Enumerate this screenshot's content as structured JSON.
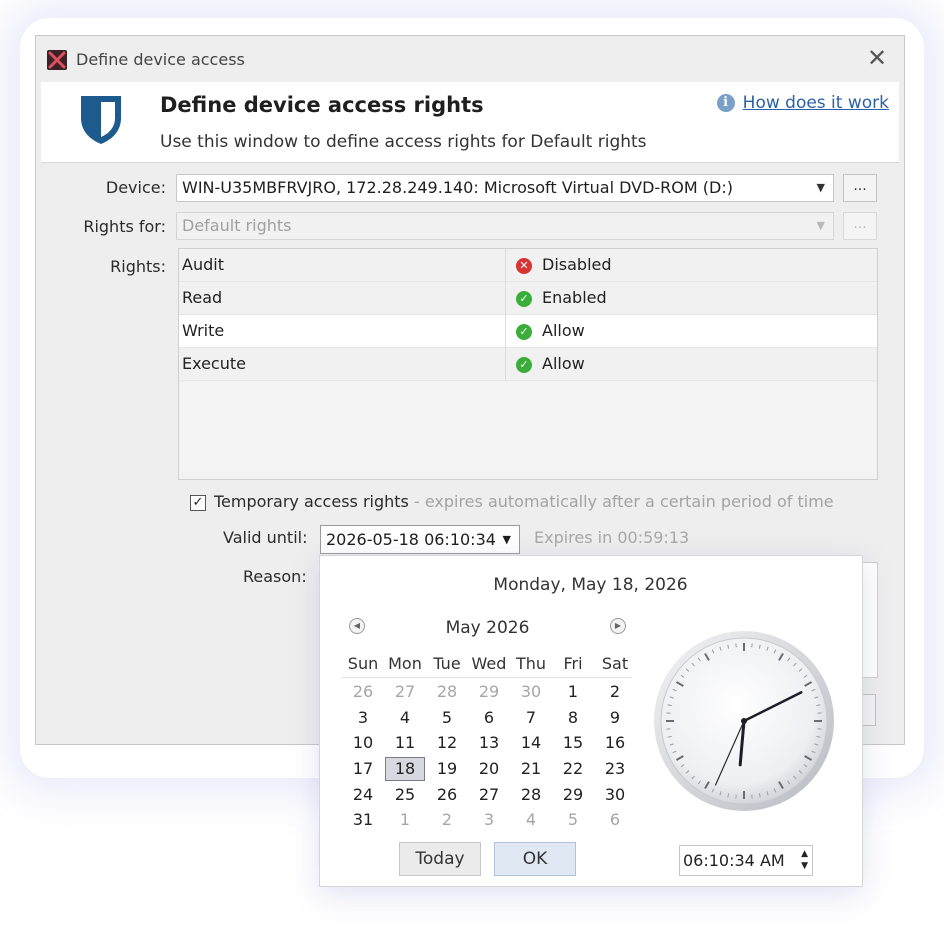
{
  "window": {
    "title": "Define device access",
    "close_glyph": "✕"
  },
  "header": {
    "title": "Define device access rights",
    "subtitle": "Use this window to define access rights for Default rights",
    "help_icon_glyph": "i",
    "help_link": "How does it work"
  },
  "form": {
    "device_label": "Device:",
    "device_value": "WIN-U35MBFRVJRO, 172.28.249.140: Microsoft Virtual DVD-ROM (D:)",
    "rights_for_label": "Rights for:",
    "rights_for_value": "Default rights",
    "browse_label": "...",
    "rights_label": "Rights:",
    "dropdown_glyph": "▼"
  },
  "rights": [
    {
      "name": "Audit",
      "status": "Disabled",
      "state": "error"
    },
    {
      "name": "Read",
      "status": "Enabled",
      "state": "ok"
    },
    {
      "name": "Write",
      "status": "Allow",
      "state": "ok"
    },
    {
      "name": "Execute",
      "status": "Allow",
      "state": "ok"
    }
  ],
  "temporary": {
    "checked": true,
    "check_glyph": "✓",
    "label": "Temporary access rights",
    "hint": " - expires automatically after a certain period of time",
    "valid_until_label": "Valid until:",
    "valid_until_value": "2026-05-18 06:10:34",
    "expires_text": "Expires in 00:59:13",
    "reason_label": "Reason:"
  },
  "calendar": {
    "full_date": "Monday, May 18, 2026",
    "month_title": "May 2026",
    "prev_glyph": "◀",
    "next_glyph": "▶",
    "weekdays": [
      "Sun",
      "Mon",
      "Tue",
      "Wed",
      "Thu",
      "Fri",
      "Sat"
    ],
    "weeks": [
      [
        "26",
        "27",
        "28",
        "29",
        "30",
        "1",
        "2"
      ],
      [
        "3",
        "4",
        "5",
        "6",
        "7",
        "8",
        "9"
      ],
      [
        "10",
        "11",
        "12",
        "13",
        "14",
        "15",
        "16"
      ],
      [
        "17",
        "18",
        "19",
        "20",
        "21",
        "22",
        "23"
      ],
      [
        "24",
        "25",
        "26",
        "27",
        "28",
        "29",
        "30"
      ],
      [
        "31",
        "1",
        "2",
        "3",
        "4",
        "5",
        "6"
      ]
    ],
    "selected_day": "18",
    "today_button": "Today",
    "ok_button": "OK",
    "time_value": "06:10:34 AM",
    "spin_up_glyph": "▲",
    "spin_down_glyph": "▼",
    "clock": {
      "hours": 6,
      "minutes": 10,
      "seconds": 34
    }
  },
  "colors": {
    "shield": "#1d5a8e",
    "status_error": "#d83434",
    "status_ok": "#3aad3a",
    "link": "#2c62a8",
    "selected_day_bg": "#d8d8e0"
  }
}
